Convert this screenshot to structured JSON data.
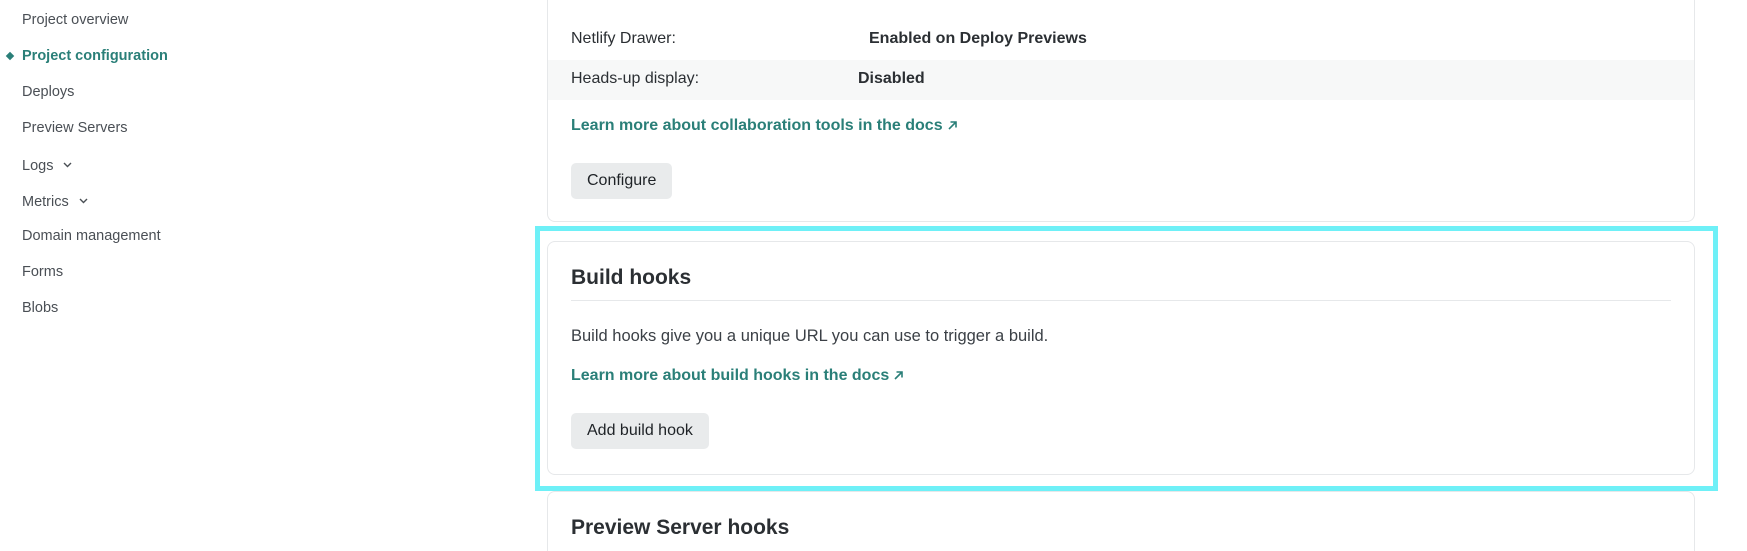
{
  "sidebar": {
    "items": [
      {
        "label": "Project overview"
      },
      {
        "label": "Project configuration"
      },
      {
        "label": "Deploys"
      },
      {
        "label": "Preview Servers"
      },
      {
        "label": "Logs"
      },
      {
        "label": "Metrics"
      },
      {
        "label": "Domain management"
      },
      {
        "label": "Forms"
      },
      {
        "label": "Blobs"
      }
    ]
  },
  "collaboration": {
    "rows": [
      {
        "label": "Netlify Drawer:",
        "value": "Enabled on Deploy Previews"
      },
      {
        "label": "Heads-up display:",
        "value": "Disabled"
      }
    ],
    "docs_link": "Learn more about collaboration tools in the docs",
    "configure_button": "Configure"
  },
  "build_hooks": {
    "title": "Build hooks",
    "description": "Build hooks give you a unique URL you can use to trigger a build.",
    "docs_link": "Learn more about build hooks in the docs",
    "add_button": "Add build hook"
  },
  "preview_server_hooks": {
    "title": "Preview Server hooks"
  },
  "colors": {
    "accent": "#2a7f78",
    "highlight": "#6ef0f7",
    "button_bg": "#e9ebec"
  }
}
